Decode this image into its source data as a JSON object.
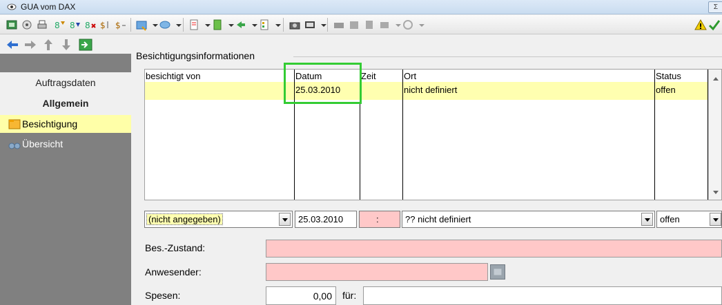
{
  "window": {
    "title": "GUA vom DAX",
    "sys_button": "Σ"
  },
  "toolbar": {
    "icons": [
      "form-icon",
      "view-icon",
      "print-icon",
      "filter-icon",
      "filter2-icon",
      "filter-remove-icon",
      "sort-icon",
      "sort2-icon",
      "new-doc-icon",
      "globe-icon",
      "document-icon",
      "note-icon",
      "forward-icon",
      "sheet-icon",
      "camera-icon",
      "film-icon",
      "chart-icon",
      "calendar-icon",
      "book-icon",
      "phone-icon",
      "spiral-icon",
      "warning-icon",
      "check-icon"
    ]
  },
  "nav": {
    "auftragsdaten": "Auftragsdaten",
    "allgemein": "Allgemein",
    "besichtigung": "Besichtigung",
    "uebersicht": "Übersicht"
  },
  "section": {
    "caption": "Besichtigungsinformationen"
  },
  "grid": {
    "columns": [
      "besichtigt von",
      "Datum",
      "Zeit",
      "Ort",
      "Status"
    ],
    "rows": [
      {
        "besichtigt_von": "",
        "datum": "25.03.2010",
        "zeit": "",
        "ort": "nicht definiert",
        "status": "offen"
      }
    ]
  },
  "edit": {
    "person": "(nicht angegeben)",
    "datum": "25.03.2010",
    "zeit": ":",
    "ort": "??  nicht definiert",
    "status": "offen"
  },
  "form": {
    "zustand_label": "Bes.-Zustand:",
    "anwesender_label": "Anwesender:",
    "spesen_label": "Spesen:",
    "spesen_value": "0,00",
    "fuer_label": "für:"
  }
}
